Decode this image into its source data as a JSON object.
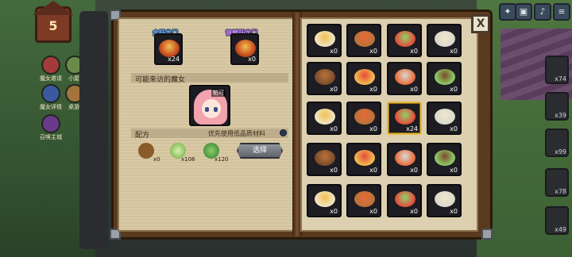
{
  "hud": {
    "level": "5",
    "left_labels": [
      "魔女邀请",
      "小屋",
      "魔女详情",
      "桌游",
      "召唤主城"
    ],
    "top_buttons": [
      "?",
      "?",
      "?",
      "?",
      "?"
    ],
    "right_counts": [
      "x74",
      "x39",
      "x99",
      "x78",
      "x49"
    ]
  },
  "book": {
    "results": [
      {
        "name": "金跃龙门",
        "count": "x24",
        "name_color": "#6fb8ff"
      },
      {
        "name": "锦鲤跃龙门",
        "count": "x0",
        "name_color": "#d88bff"
      }
    ],
    "visitor_title": "可能来访的魔女",
    "witch_name": "帕可",
    "recipe_title": "配方",
    "prefer_low_quality": "优先使用低品质材料",
    "ingredients": [
      {
        "icon": "tanuki-icon",
        "count": "x0"
      },
      {
        "icon": "cabbage-icon",
        "count": "x108"
      },
      {
        "icon": "clover-icon",
        "count": "x120"
      }
    ],
    "choose_label": "选择",
    "close_label": "X",
    "grid": [
      [
        "x0",
        "x0",
        "x0",
        "x0"
      ],
      [
        "x0",
        "x0",
        "x0",
        "x0"
      ],
      [
        "x0",
        "x0",
        "x24",
        "x0"
      ],
      [
        "x0",
        "x0",
        "x0",
        "x0"
      ],
      [
        "x0",
        "x0",
        "x0",
        "x0"
      ]
    ]
  },
  "colors": {
    "dish_palette": [
      "#f2c052",
      "#e86a3a",
      "#8fd16a",
      "#f0e6c8",
      "#b8733a",
      "#e64a3a",
      "#d9d9d0",
      "#7a4a2a"
    ],
    "selected_border": "#e5b83a"
  }
}
